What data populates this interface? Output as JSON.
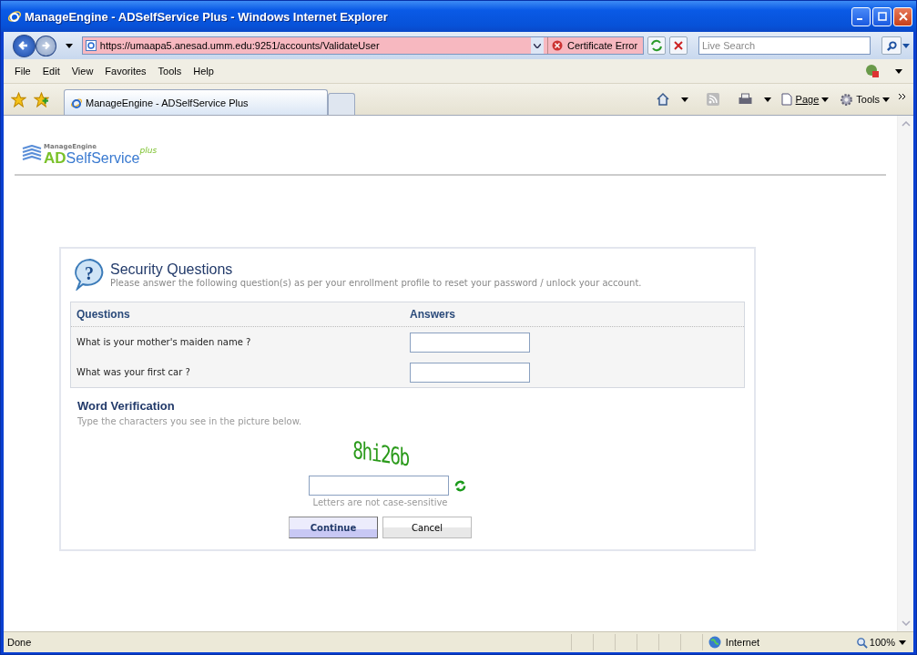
{
  "window": {
    "title": "ManageEngine - ADSelfService Plus - Windows Internet Explorer"
  },
  "address_bar": {
    "url": "https://umaapa5.anesad.umm.edu:9251/accounts/ValidateUser",
    "certificate": "Certificate Error"
  },
  "search": {
    "placeholder": "Live Search"
  },
  "menu": [
    "File",
    "Edit",
    "View",
    "Favorites",
    "Tools",
    "Help"
  ],
  "tabs": [
    {
      "label": "ManageEngine - ADSelfService Plus",
      "selected": true
    }
  ],
  "command_bar": {
    "page": "Page",
    "tools": "Tools"
  },
  "logo": {
    "vendor": "ManageEngine",
    "prefix": "AD",
    "name": "SelfService",
    "suffix": "plus"
  },
  "panel": {
    "icon": "?",
    "title": "Security Questions",
    "subtitle": "Please answer the following question(s) as per your enrollment profile to reset your password / unlock your account.",
    "columns": [
      "Questions",
      "Answers"
    ],
    "questions": [
      {
        "question": "What is your mother's maiden name ?"
      },
      {
        "question": "What was your first car ?"
      }
    ],
    "verification": {
      "title": "Word Verification",
      "hint": "Type the characters you see in the picture below.",
      "captcha": "8hi26b",
      "note": "Letters are not case-sensitive"
    },
    "buttons": [
      "Continue",
      "Cancel"
    ]
  },
  "status_bar": {
    "status": "Done",
    "zone": "Internet",
    "zoom": "100%"
  }
}
